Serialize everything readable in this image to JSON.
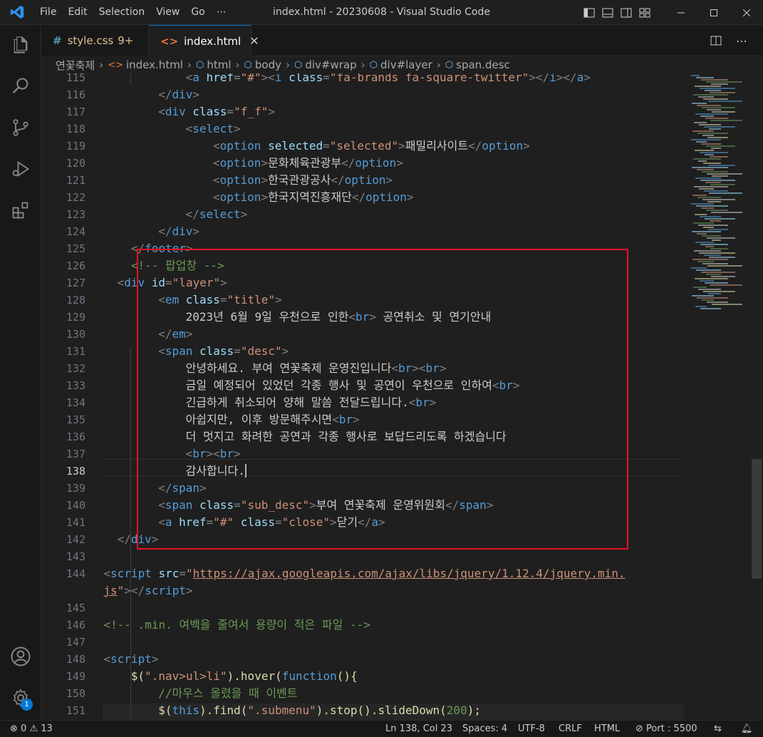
{
  "window": {
    "title": "index.html - 20230608 - Visual Studio Code",
    "menu": [
      "File",
      "Edit",
      "Selection",
      "View",
      "Go",
      "⋯"
    ]
  },
  "tabs": [
    {
      "icon": "#",
      "label": "style.css",
      "count": "9+"
    },
    {
      "icon": "<>",
      "label": "index.html",
      "close": "✕"
    }
  ],
  "breadcrumb": [
    "연꽃축제",
    "index.html",
    "html",
    "body",
    "div#wrap",
    "div#layer",
    "span.desc"
  ],
  "editor": {
    "line_numbers": [
      "115",
      "116",
      "117",
      "118",
      "119",
      "120",
      "121",
      "122",
      "123",
      "124",
      "125",
      "126",
      "127",
      "128",
      "129",
      "130",
      "131",
      "132",
      "133",
      "134",
      "135",
      "136",
      "137",
      "138",
      "139",
      "140",
      "141",
      "142",
      "143",
      "144",
      "",
      "145",
      "146",
      "147",
      "148",
      "149",
      "150",
      "151"
    ],
    "current_line": "138",
    "lines": [
      {
        "tok": [
          [
            "<",
            "p"
          ],
          [
            "a ",
            "t"
          ],
          [
            "href",
            "a"
          ],
          [
            "=",
            "p"
          ],
          [
            "\"#\"",
            "s"
          ],
          [
            "><",
            "p"
          ],
          [
            "i ",
            "t"
          ],
          [
            "class",
            "a"
          ],
          [
            "=",
            "p"
          ],
          [
            "\"fa-brands fa-square-twitter\"",
            "s"
          ],
          [
            "></",
            "p"
          ],
          [
            "i",
            "t"
          ],
          [
            "></",
            "p"
          ],
          [
            "a",
            "t"
          ],
          [
            ">",
            "p"
          ]
        ]
      },
      {
        "tok": [
          [
            "</",
            "p"
          ],
          [
            "div",
            "t"
          ],
          [
            ">",
            "p"
          ]
        ]
      },
      {
        "tok": [
          [
            "<",
            "p"
          ],
          [
            "div ",
            "t"
          ],
          [
            "class",
            "a"
          ],
          [
            "=",
            "p"
          ],
          [
            "\"f_f\"",
            "s"
          ],
          [
            ">",
            "p"
          ]
        ]
      },
      {
        "tok": [
          [
            "<",
            "p"
          ],
          [
            "select",
            "t"
          ],
          [
            ">",
            "p"
          ]
        ]
      },
      {
        "tok": [
          [
            "<",
            "p"
          ],
          [
            "option ",
            "t"
          ],
          [
            "selected",
            "a"
          ],
          [
            "=",
            "p"
          ],
          [
            "\"selected\"",
            "s"
          ],
          [
            ">",
            "p"
          ],
          [
            "패밀리사이트",
            ""
          ],
          [
            "</",
            "p"
          ],
          [
            "option",
            "t"
          ],
          [
            ">",
            "p"
          ]
        ]
      },
      {
        "tok": [
          [
            "<",
            "p"
          ],
          [
            "option",
            "t"
          ],
          [
            ">",
            "p"
          ],
          [
            "문화체육관광부",
            ""
          ],
          [
            "</",
            "p"
          ],
          [
            "option",
            "t"
          ],
          [
            ">",
            "p"
          ]
        ]
      },
      {
        "tok": [
          [
            "<",
            "p"
          ],
          [
            "option",
            "t"
          ],
          [
            ">",
            "p"
          ],
          [
            "한국관광공사",
            ""
          ],
          [
            "</",
            "p"
          ],
          [
            "option",
            "t"
          ],
          [
            ">",
            "p"
          ]
        ]
      },
      {
        "tok": [
          [
            "<",
            "p"
          ],
          [
            "option",
            "t"
          ],
          [
            ">",
            "p"
          ],
          [
            "한국지역진흥재단",
            ""
          ],
          [
            "</",
            "p"
          ],
          [
            "option",
            "t"
          ],
          [
            ">",
            "p"
          ]
        ]
      },
      {
        "tok": [
          [
            "</",
            "p"
          ],
          [
            "select",
            "t"
          ],
          [
            ">",
            "p"
          ]
        ]
      },
      {
        "tok": [
          [
            "</",
            "p"
          ],
          [
            "div",
            "t"
          ],
          [
            ">",
            "p"
          ]
        ]
      },
      {
        "tok": [
          [
            "</",
            "p"
          ],
          [
            "footer",
            "t"
          ],
          [
            ">",
            "p"
          ]
        ]
      },
      {
        "tok": [
          [
            "<!-- 팝업창 -->",
            "c"
          ]
        ]
      },
      {
        "tok": [
          [
            "<",
            "p"
          ],
          [
            "div ",
            "t"
          ],
          [
            "id",
            "a"
          ],
          [
            "=",
            "p"
          ],
          [
            "\"layer\"",
            "s"
          ],
          [
            ">",
            "p"
          ]
        ]
      },
      {
        "tok": [
          [
            "<",
            "p"
          ],
          [
            "em ",
            "t"
          ],
          [
            "class",
            "a"
          ],
          [
            "=",
            "p"
          ],
          [
            "\"title\"",
            "s"
          ],
          [
            ">",
            "p"
          ]
        ]
      },
      {
        "tok": [
          [
            "2023년 6월 9일 우천으로 인한",
            ""
          ],
          [
            "<",
            "p"
          ],
          [
            "br",
            "t"
          ],
          [
            ">",
            "p"
          ],
          [
            " 공연취소 및 연기안내",
            ""
          ]
        ]
      },
      {
        "tok": [
          [
            "</",
            "p"
          ],
          [
            "em",
            "t"
          ],
          [
            ">",
            "p"
          ]
        ]
      },
      {
        "tok": [
          [
            "<",
            "p"
          ],
          [
            "span ",
            "t"
          ],
          [
            "class",
            "a"
          ],
          [
            "=",
            "p"
          ],
          [
            "\"desc\"",
            "s"
          ],
          [
            ">",
            "p"
          ]
        ]
      },
      {
        "tok": [
          [
            "안녕하세요. 부여 연꽃축제 운영진입니다",
            ""
          ],
          [
            "<",
            "p"
          ],
          [
            "br",
            "t"
          ],
          [
            "><",
            "p"
          ],
          [
            "br",
            "t"
          ],
          [
            ">",
            "p"
          ]
        ]
      },
      {
        "tok": [
          [
            "금일 예정되어 있었던 각종 행사 및 공연이 우천으로 인하여",
            ""
          ],
          [
            "<",
            "p"
          ],
          [
            "br",
            "t"
          ],
          [
            ">",
            "p"
          ]
        ]
      },
      {
        "tok": [
          [
            "긴급하게 취소되어 양해 말씀 전달드립니다.",
            ""
          ],
          [
            "<",
            "p"
          ],
          [
            "br",
            "t"
          ],
          [
            ">",
            "p"
          ]
        ]
      },
      {
        "tok": [
          [
            "아쉽지만, 이후 방문해주시면",
            ""
          ],
          [
            "<",
            "p"
          ],
          [
            "br",
            "t"
          ],
          [
            ">",
            "p"
          ]
        ]
      },
      {
        "tok": [
          [
            "더 멋지고 화려한 공연과 각종 행사로 보답드리도록 하겠습니다",
            ""
          ]
        ]
      },
      {
        "tok": [
          [
            "<",
            "p"
          ],
          [
            "br",
            "t"
          ],
          [
            "><",
            "p"
          ],
          [
            "br",
            "t"
          ],
          [
            ">",
            "p"
          ]
        ]
      },
      {
        "tok": [
          [
            "감사합니다.",
            ""
          ]
        ]
      },
      {
        "tok": [
          [
            "</",
            "p"
          ],
          [
            "span",
            "t"
          ],
          [
            ">",
            "p"
          ]
        ]
      },
      {
        "tok": [
          [
            "<",
            "p"
          ],
          [
            "span ",
            "t"
          ],
          [
            "class",
            "a"
          ],
          [
            "=",
            "p"
          ],
          [
            "\"sub_desc\"",
            "s"
          ],
          [
            ">",
            "p"
          ],
          [
            "부여 연꽃축제 운영위원회",
            ""
          ],
          [
            "</",
            "p"
          ],
          [
            "span",
            "t"
          ],
          [
            ">",
            "p"
          ]
        ]
      },
      {
        "tok": [
          [
            "<",
            "p"
          ],
          [
            "a ",
            "t"
          ],
          [
            "href",
            "a"
          ],
          [
            "=",
            "p"
          ],
          [
            "\"#\" ",
            "s"
          ],
          [
            "class",
            "a"
          ],
          [
            "=",
            "p"
          ],
          [
            "\"close\"",
            "s"
          ],
          [
            ">",
            "p"
          ],
          [
            "닫기",
            ""
          ],
          [
            "</",
            "p"
          ],
          [
            "a",
            "t"
          ],
          [
            ">",
            "p"
          ]
        ]
      },
      {
        "tok": [
          [
            "</",
            "p"
          ],
          [
            "div",
            "t"
          ],
          [
            ">",
            "p"
          ]
        ]
      },
      {
        "tok": []
      },
      {
        "tok": [
          [
            "<",
            "p"
          ],
          [
            "script ",
            "t"
          ],
          [
            "src",
            "a"
          ],
          [
            "=",
            "p"
          ],
          [
            "\"",
            "s"
          ],
          [
            "https://ajax.googleapis.com/ajax/libs/jquery/1.12.4/jquery.min.",
            "u"
          ]
        ]
      },
      {
        "tok": [
          [
            "js",
            "u"
          ],
          [
            "\"",
            "s"
          ],
          [
            "></",
            "p"
          ],
          [
            "script",
            "t"
          ],
          [
            ">",
            "p"
          ]
        ]
      },
      {
        "tok": []
      },
      {
        "tok": [
          [
            "<!-- .min. 여백을 줄여서 용량이 적은 파일 -->",
            "c"
          ]
        ]
      },
      {
        "tok": []
      },
      {
        "tok": [
          [
            "<",
            "p"
          ],
          [
            "script",
            "t"
          ],
          [
            ">",
            "p"
          ]
        ]
      },
      {
        "tok": [
          [
            "$(",
            "y"
          ],
          [
            "\".nav>ul>li\"",
            "s"
          ],
          [
            ").",
            "y"
          ],
          [
            "hover",
            "y"
          ],
          [
            "(",
            "y"
          ],
          [
            "function",
            "t"
          ],
          [
            "(){",
            "y"
          ]
        ]
      },
      {
        "tok": [
          [
            "//마우스 올렸을 때 이벤트",
            "c"
          ]
        ]
      },
      {
        "tok": [
          [
            "$(",
            "y"
          ],
          [
            "this",
            "t"
          ],
          [
            ").",
            "y"
          ],
          [
            "find",
            "y"
          ],
          [
            "(",
            "y"
          ],
          [
            "\".submenu\"",
            "s"
          ],
          [
            ").",
            "y"
          ],
          [
            "stop",
            "y"
          ],
          [
            "().",
            "y"
          ],
          [
            "slideDown",
            "y"
          ],
          [
            "(",
            "y"
          ],
          [
            "200",
            "c"
          ],
          [
            ");",
            "y"
          ]
        ]
      }
    ]
  },
  "status": {
    "errors": "0",
    "warnings": "13",
    "position": "Ln 138, Col 23",
    "spaces": "Spaces: 4",
    "encoding": "UTF-8",
    "eol": "CRLF",
    "language": "HTML",
    "port": "Port : 5500"
  },
  "accounts_badge": "1",
  "colors": {
    "accent": "#0078d4",
    "highlight_box": "#e81123"
  }
}
